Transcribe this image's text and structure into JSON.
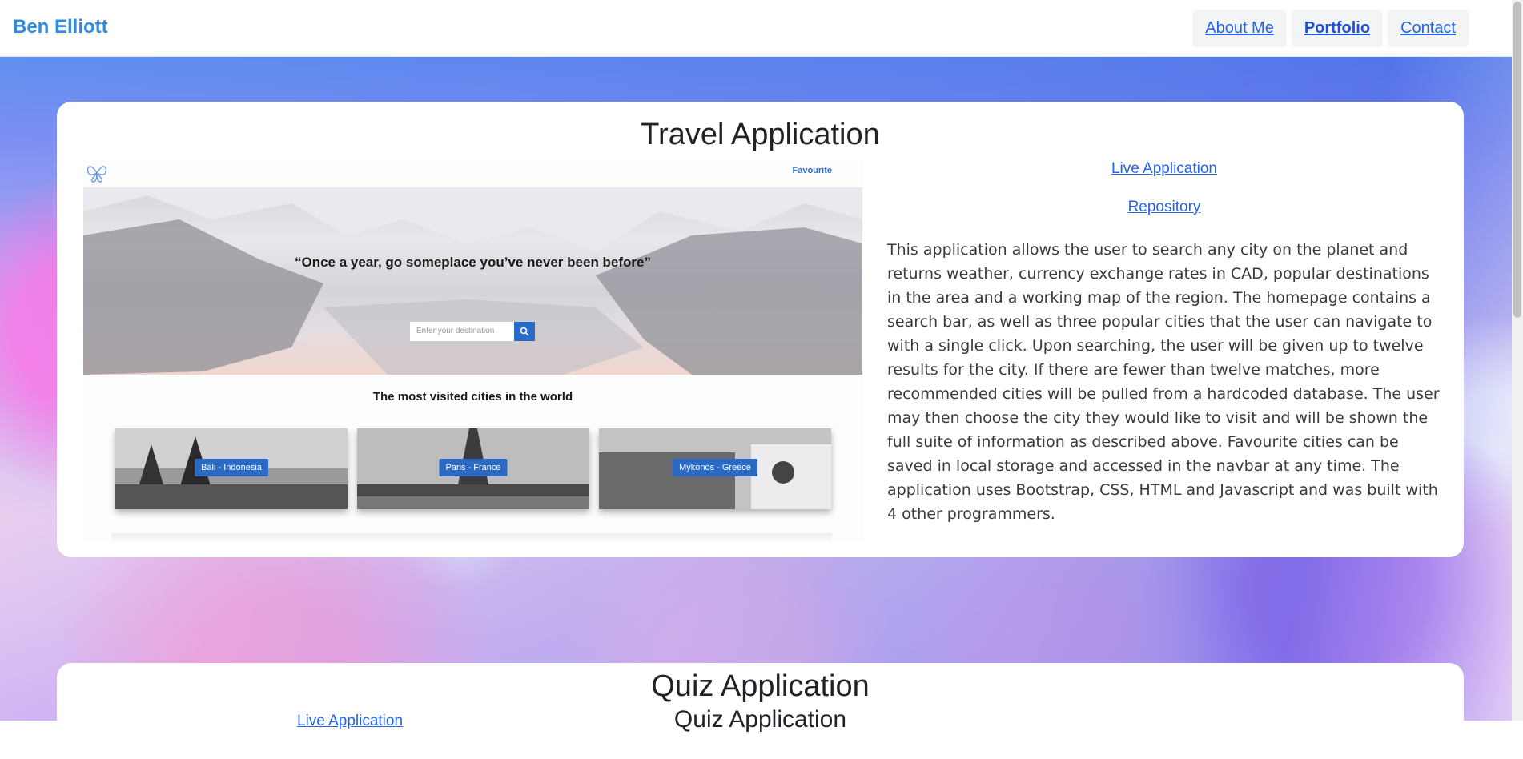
{
  "navbar": {
    "brand": "Ben Elliott",
    "links": [
      {
        "label": "About Me"
      },
      {
        "label": "Portfolio"
      },
      {
        "label": "Contact"
      }
    ]
  },
  "projects": [
    {
      "title": "Travel Application",
      "live_label": "Live Application",
      "repo_label": "Repository",
      "description": "This application allows the user to search any city on the planet and returns weather, currency exchange rates in CAD, popular destinations in the area and a working map of the region. The homepage contains a search bar, as well as three popular cities that the user can navigate to with a single click. Upon searching, the user will be given up to twelve results for the city. If there are fewer than twelve matches, more recommended cities will be pulled from a hardcoded database. The user may then choose the city they would like to visit and will be shown the full suite of information as described above. Favourite cities can be saved in local storage and accessed in the navbar at any time. The application uses Bootstrap, CSS, HTML and Javascript and was built with 4 other programmers.",
      "screenshot": {
        "favourite_label": "Favourite",
        "quote": "“Once a year, go someplace you’ve never been before”",
        "search_placeholder": "Enter your destination",
        "most_visited": "The most visited cities in the world",
        "cities": [
          "Bali - Indonesia",
          "Paris - France",
          "Mykonos - Greece"
        ]
      }
    },
    {
      "title": "Quiz Application",
      "live_label": "Live Application",
      "subtitle": "Quiz Application"
    }
  ]
}
